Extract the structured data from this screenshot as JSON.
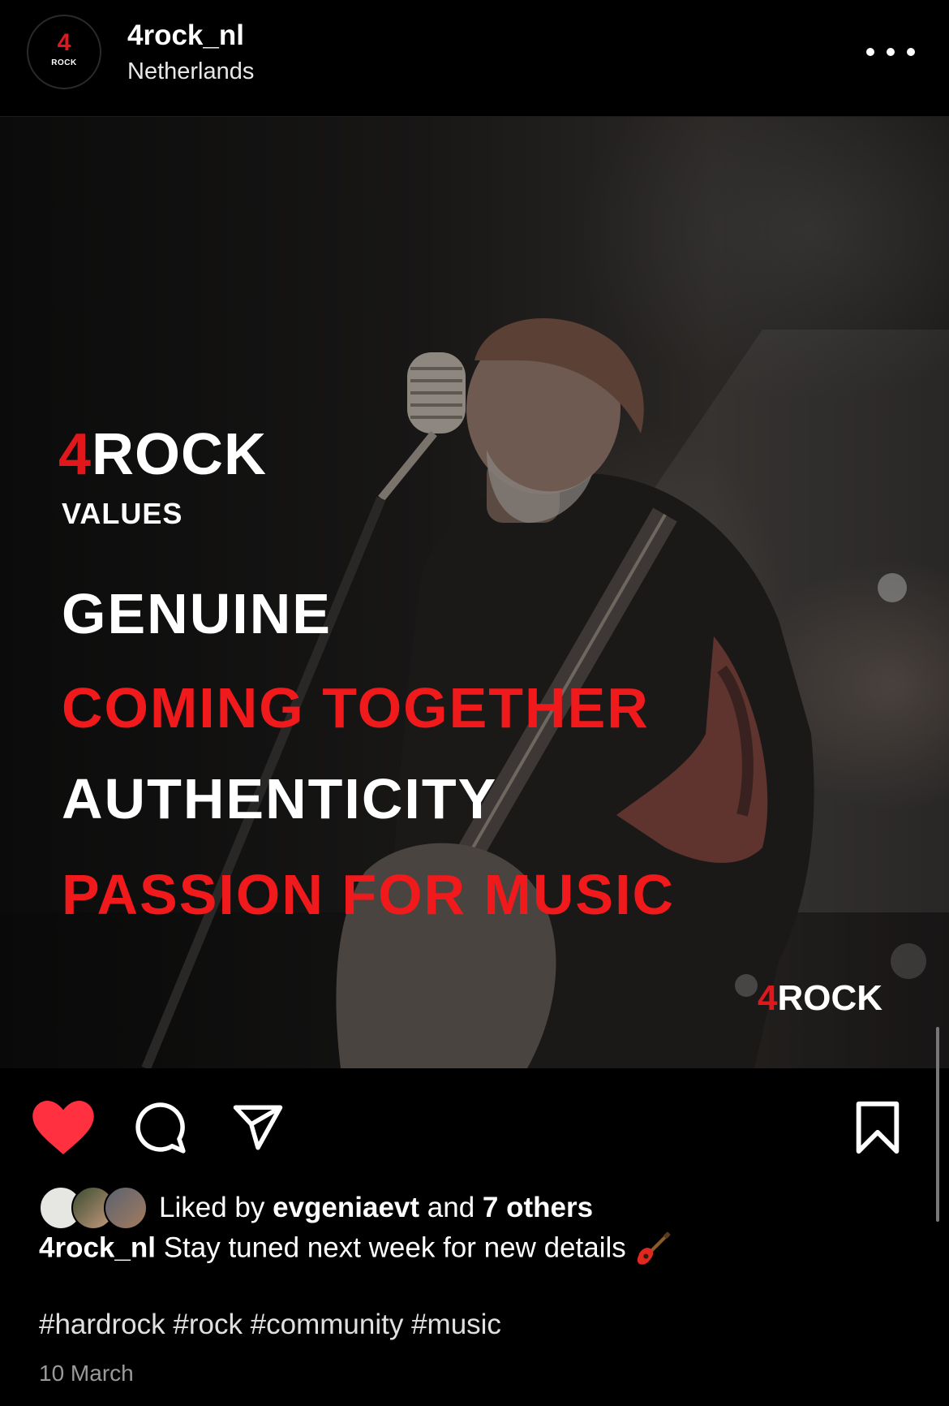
{
  "header": {
    "avatar_number": "4",
    "avatar_word": "ROCK",
    "username": "4rock_nl",
    "location": "Netherlands"
  },
  "post": {
    "brand_number": "4",
    "brand_word": "ROCK",
    "subtitle": "VALUES",
    "values": [
      {
        "text": "GENUINE",
        "color": "#ffffff"
      },
      {
        "text": "COMING TOGETHER",
        "color": "#f01a1d"
      },
      {
        "text": "AUTHENTICITY",
        "color": "#ffffff"
      },
      {
        "text": "PASSION FOR MUSIC",
        "color": "#f01a1d"
      }
    ],
    "corner_brand_number": "4",
    "corner_brand_word": "ROCK"
  },
  "actions": {
    "like_icon": "heart-icon-filled",
    "comment_icon": "comment-icon",
    "share_icon": "send-icon",
    "save_icon": "bookmark-icon",
    "like_color": "#ff3040"
  },
  "likes": {
    "prefix": "Liked by",
    "user": "evgeniaevt",
    "conjunction": "and",
    "others": "7 others"
  },
  "caption": {
    "author": "4rock_nl",
    "text": "Stay tuned next week for new details",
    "emoji_icon": "guitar-icon"
  },
  "hashtags": "#hardrock #rock #community #music",
  "date": "10 March"
}
